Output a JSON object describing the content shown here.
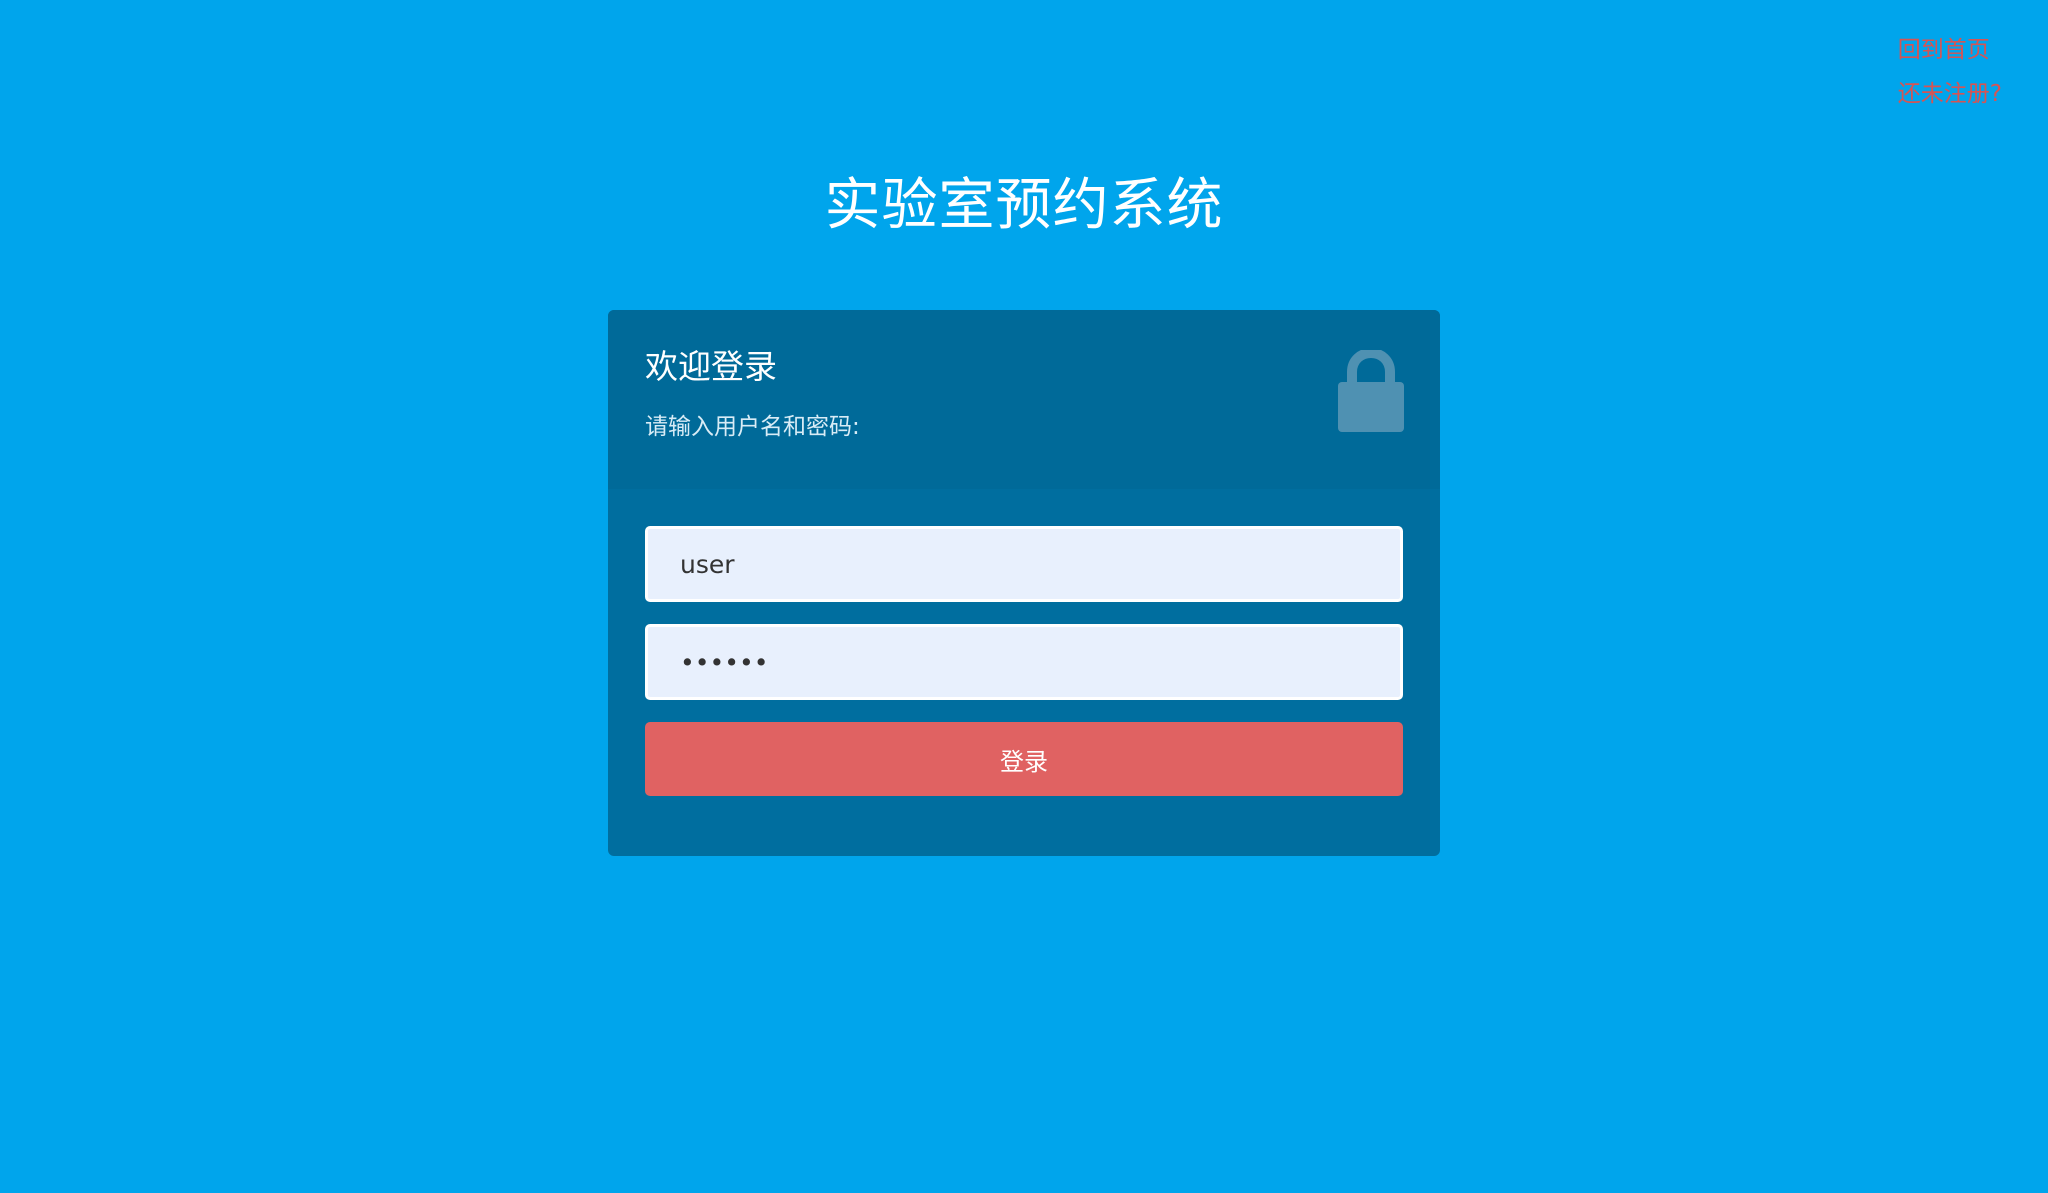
{
  "top_links": {
    "home": "回到首页",
    "register": "还未注册?"
  },
  "app": {
    "title": "实验室预约系统"
  },
  "login_card": {
    "title": "欢迎登录",
    "subtitle": "请输入用户名和密码:",
    "username_value": "user",
    "password_value": "••••••",
    "login_button_label": "登录",
    "lock_icon": "lock-icon"
  },
  "colors": {
    "background": "#00a5ec",
    "card_header": "#006a99",
    "card_body": "#006e9f",
    "button": "#e06262",
    "link": "#d65454",
    "input_bg": "#e8f0fd"
  }
}
